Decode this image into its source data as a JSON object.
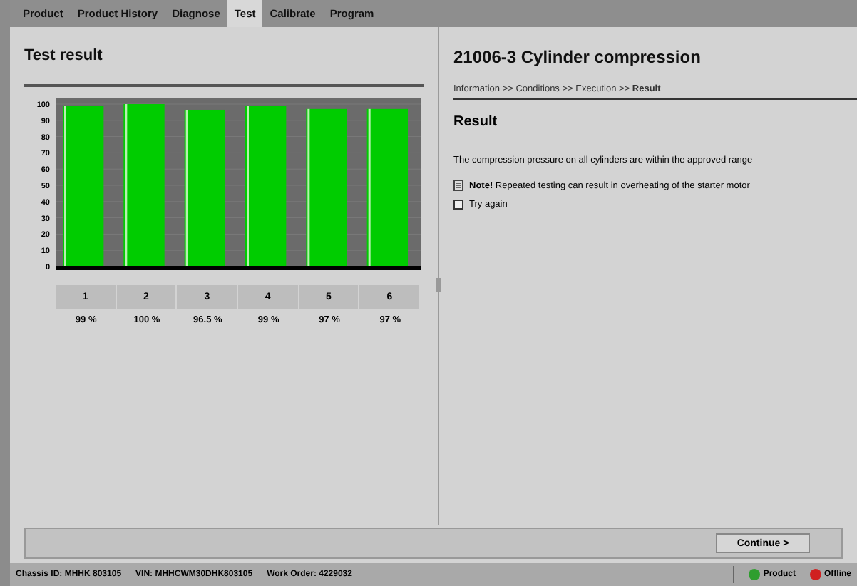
{
  "tabs": [
    {
      "label": "Product",
      "selected": false
    },
    {
      "label": "Product History",
      "selected": false
    },
    {
      "label": "Diagnose",
      "selected": false
    },
    {
      "label": "Test",
      "selected": true
    },
    {
      "label": "Calibrate",
      "selected": false
    },
    {
      "label": "Program",
      "selected": false
    }
  ],
  "left_panel": {
    "title": "Test result",
    "chart_data": {
      "type": "bar",
      "categories": [
        "1",
        "2",
        "3",
        "4",
        "5",
        "6"
      ],
      "series": [
        {
          "color": "#00cc00",
          "values": [
            99,
            100,
            96.5,
            99,
            97,
            97
          ]
        }
      ],
      "ylim": [
        0,
        100
      ],
      "grid": true,
      "yticks": [
        0,
        10,
        20,
        30,
        40,
        50,
        60,
        70,
        80,
        90,
        100
      ]
    },
    "table": {
      "values": [
        "99 %",
        "100 %",
        "96.5 %",
        "99 %",
        "97 %",
        "97 %"
      ]
    }
  },
  "right_panel": {
    "title": "21006-3 Cylinder compression",
    "breadcrumb": "Information >> Conditions >> Execution >> **Result**",
    "heading": "Result",
    "message": "The compression pressure on all cylinders are within the approved range",
    "note": "**Note!** Repeated testing can result in overheating of the starter motor",
    "checkbox": {
      "label": "Try again",
      "checked": false
    }
  },
  "footer": {
    "button": "Continue >"
  },
  "status_bar": {
    "items": [
      "Chassis ID: MHHK 803105",
      "VIN: MHHCWM30DHK803105",
      "Work Order: 4229032"
    ],
    "indicators": [
      {
        "label": "Product",
        "color": "#2e9e2e"
      },
      {
        "label": "Offline",
        "color": "#d02020"
      }
    ]
  }
}
